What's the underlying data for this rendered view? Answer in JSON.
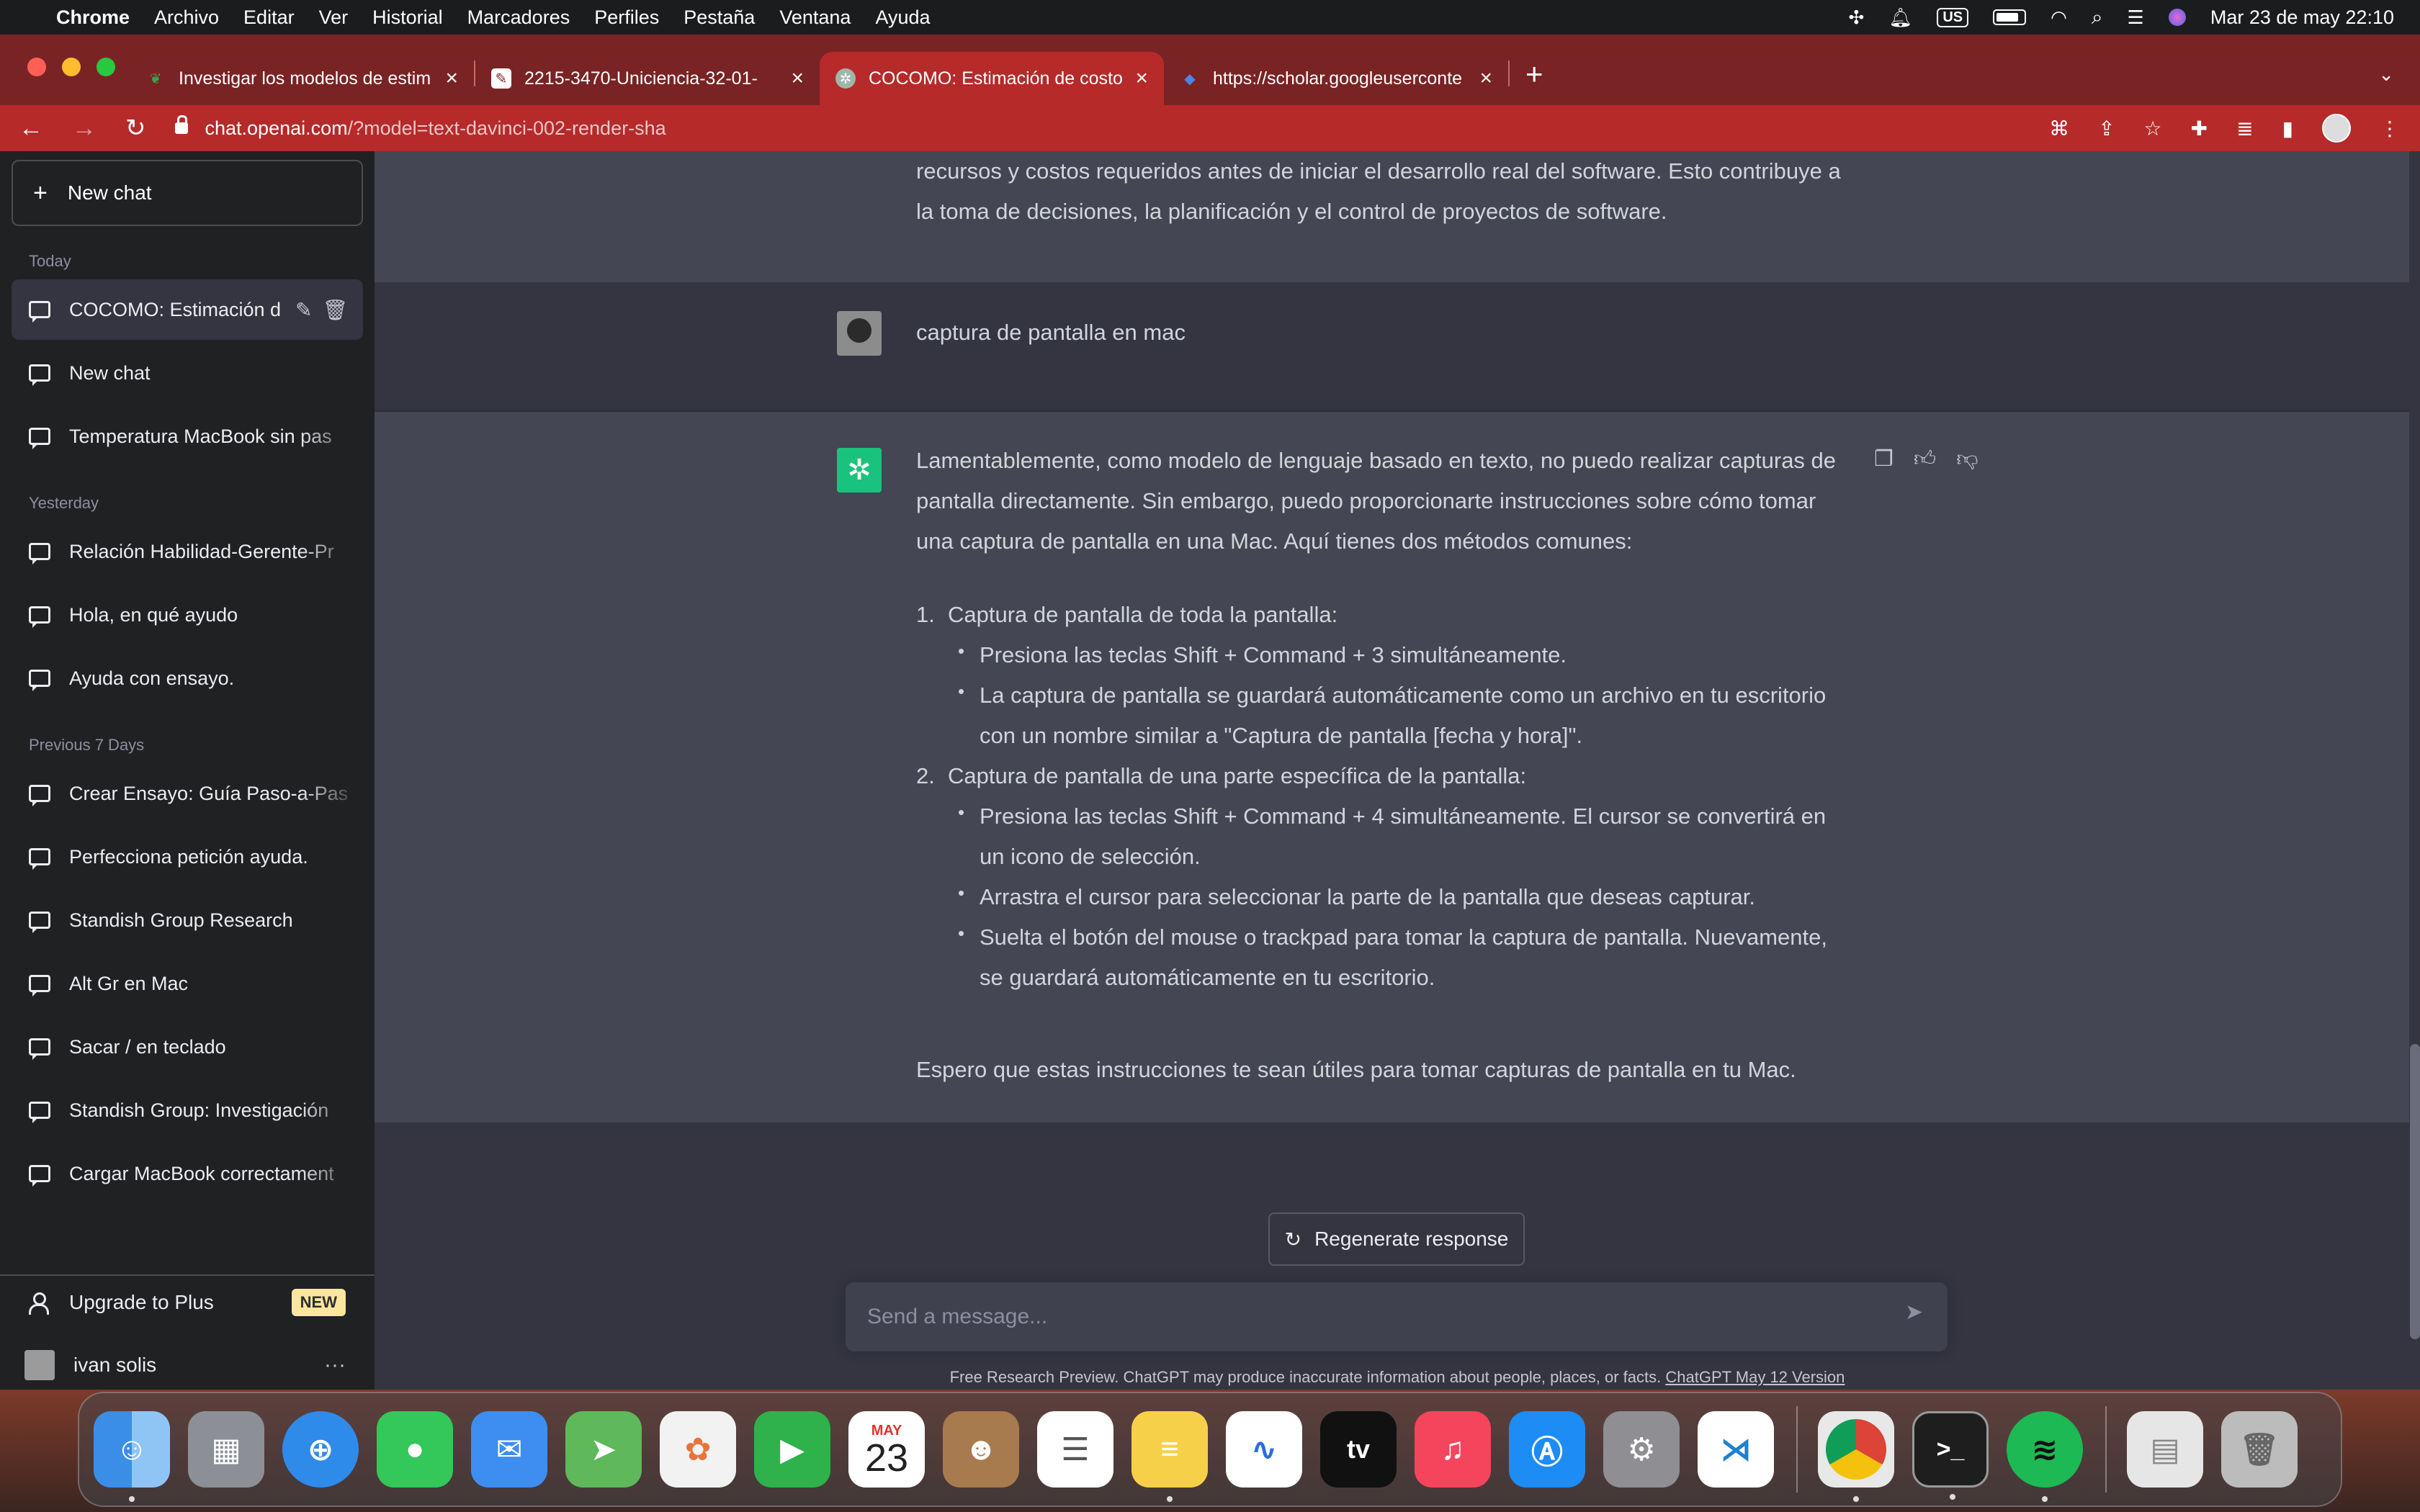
{
  "menubar": {
    "app": "Chrome",
    "items": [
      "Archivo",
      "Editar",
      "Ver",
      "Historial",
      "Marcadores",
      "Perfiles",
      "Pestaña",
      "Ventana",
      "Ayuda"
    ],
    "input_source": "US",
    "datetime": "Mar 23 de may 22:10"
  },
  "tabs": [
    {
      "title": "Investigar los modelos de estim",
      "favicon": "leaf-icon",
      "color": "#3da14c"
    },
    {
      "title": "2215-3470-Uniciencia-32-01-",
      "favicon": "document-icon",
      "color": "#ffffff"
    },
    {
      "title": "COCOMO: Estimación de costo",
      "favicon": "chatgpt-icon",
      "color": "#9fb7a8"
    },
    {
      "title": "https://scholar.googleuserconte",
      "favicon": "scholar-icon",
      "color": "#4a86e8"
    }
  ],
  "address": {
    "host": "chat.openai.com",
    "path": "/?model=text-davinci-002-render-sha"
  },
  "sidebar": {
    "new_chat": "New chat",
    "sections": [
      {
        "label": "Today",
        "items": [
          "COCOMO: Estimación d",
          "New chat",
          "Temperatura MacBook sin pas"
        ]
      },
      {
        "label": "Yesterday",
        "items": [
          "Relación Habilidad-Gerente-Pr",
          "Hola, en qué ayudo",
          "Ayuda con ensayo."
        ]
      },
      {
        "label": "Previous 7 Days",
        "items": [
          "Crear Ensayo: Guía Paso-a-Pas",
          "Perfecciona petición ayuda.",
          "Standish Group Research",
          "Alt Gr en Mac",
          "Sacar / en teclado",
          "Standish Group: Investigación",
          "Cargar MacBook correctament"
        ]
      }
    ],
    "upgrade": "Upgrade to Plus",
    "upgrade_badge": "NEW",
    "user": "ivan solis"
  },
  "chat": {
    "prev_assistant": "recursos y costos requeridos antes de iniciar el desarrollo real del software. Esto contribuye a la toma de decisiones, la planificación y el control de proyectos de software.",
    "user_message": "captura de pantalla en mac",
    "assistant_intro": "Lamentablemente, como modelo de lenguaje basado en texto, no puedo realizar capturas de pantalla directamente. Sin embargo, puedo proporcionarte instrucciones sobre cómo tomar una captura de pantalla en una Mac. Aquí tienes dos métodos comunes:",
    "steps": [
      {
        "num": "1.",
        "title": "Captura de pantalla de toda la pantalla:",
        "bullets": [
          "Presiona las teclas Shift + Command + 3 simultáneamente.",
          "La captura de pantalla se guardará automáticamente como un archivo en tu escritorio con un nombre similar a \"Captura de pantalla [fecha y hora]\"."
        ]
      },
      {
        "num": "2.",
        "title": "Captura de pantalla de una parte específica de la pantalla:",
        "bullets": [
          "Presiona las teclas Shift + Command + 4 simultáneamente. El cursor se convertirá en un icono de selección.",
          "Arrastra el cursor para seleccionar la parte de la pantalla que deseas capturar.",
          "Suelta el botón del mouse o trackpad para tomar la captura de pantalla. Nuevamente, se guardará automáticamente en tu escritorio."
        ]
      }
    ],
    "assistant_outro": "Espero que estas instrucciones te sean útiles para tomar capturas de pantalla en tu Mac."
  },
  "composer": {
    "regenerate": "Regenerate response",
    "placeholder": "Send a message...",
    "footer": "Free Research Preview. ChatGPT may produce inaccurate information about people, places, or facts.",
    "footer_link": "ChatGPT May 12 Version"
  },
  "dock": {
    "calendar_month": "MAY",
    "calendar_day": "23",
    "tv_label": "tv",
    "apps": [
      {
        "name": "finder-icon",
        "color": "#3a8ee6"
      },
      {
        "name": "launchpad-icon",
        "color": "#8d8f96"
      },
      {
        "name": "safari-icon",
        "color": "#2f8bea"
      },
      {
        "name": "messages-icon",
        "color": "#34c759"
      },
      {
        "name": "mail-icon",
        "color": "#3d8ef0"
      },
      {
        "name": "maps-icon",
        "color": "#5fb85a"
      },
      {
        "name": "photos-icon",
        "color": "#f2f2f2"
      },
      {
        "name": "facetime-icon",
        "color": "#2fb24c"
      },
      {
        "name": "calendar-icon",
        "color": "#ffffff"
      },
      {
        "name": "contacts-icon",
        "color": "#a77b4e"
      },
      {
        "name": "reminders-icon",
        "color": "#ffffff"
      },
      {
        "name": "notes-icon",
        "color": "#f7d04a"
      },
      {
        "name": "freeform-icon",
        "color": "#ffffff"
      },
      {
        "name": "appletv-icon",
        "color": "#111111"
      },
      {
        "name": "music-icon",
        "color": "#f5455c"
      },
      {
        "name": "appstore-icon",
        "color": "#1d8cf4"
      },
      {
        "name": "settings-icon",
        "color": "#8e8e93"
      },
      {
        "name": "vscode-icon",
        "color": "#1e80d0"
      },
      {
        "name": "chrome-icon",
        "color": "#e8e8e8"
      },
      {
        "name": "terminal-icon",
        "color": "#1e1e1e"
      },
      {
        "name": "spotify-icon",
        "color": "#1db954"
      },
      {
        "name": "documents-icon",
        "color": "#e6e6e6"
      },
      {
        "name": "trash-icon",
        "color": "#bcbcbc"
      }
    ]
  },
  "colors": {
    "accent_gpt": "#19c37d",
    "chrome_frame": "#b62a2a",
    "sidebar": "#202123",
    "assistant_bg": "#444654",
    "user_bg": "#343541"
  }
}
